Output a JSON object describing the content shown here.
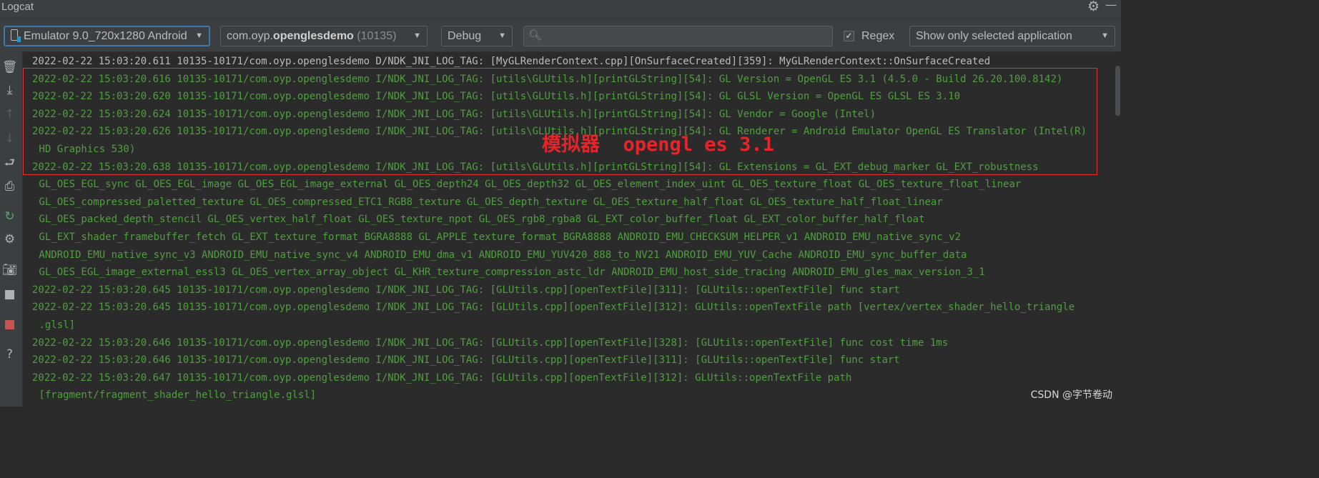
{
  "window": {
    "title": "Logcat"
  },
  "toolbar": {
    "device": "Emulator 9.0_720x1280 Android",
    "process_prefix": "com.oyp.",
    "process_bold": "openglesdemo",
    "process_pid": "(10135)",
    "log_level": "Debug",
    "search_value": "",
    "regex_checked": "✓",
    "regex_label": "Regex",
    "filter": "Show only selected application"
  },
  "sidebar_icons": [
    "trash-icon",
    "scroll-to-end-icon",
    "up-arrow-icon",
    "down-arrow-icon",
    "soft-wrap-icon",
    "print-icon",
    "restart-icon",
    "settings-icon",
    "screenshot-icon",
    "screen-record-icon",
    "stop-icon",
    "help-icon"
  ],
  "log_lines": [
    {
      "text": "2022-02-22 15:03:20.611 10135-10171/com.oyp.openglesdemo D/NDK_JNI_LOG_TAG: [MyGLRenderContext.cpp][OnSurfaceCreated][359]: MyGLRenderContext::OnSurfaceCreated",
      "level": "debug"
    },
    {
      "text": "2022-02-22 15:03:20.616 10135-10171/com.oyp.openglesdemo I/NDK_JNI_LOG_TAG: [utils\\GLUtils.h][printGLString][54]: GL Version = OpenGL ES 3.1 (4.5.0 - Build 26.20.100.8142)",
      "level": "info"
    },
    {
      "text": "2022-02-22 15:03:20.620 10135-10171/com.oyp.openglesdemo I/NDK_JNI_LOG_TAG: [utils\\GLUtils.h][printGLString][54]: GL GLSL Version = OpenGL ES GLSL ES 3.10",
      "level": "info"
    },
    {
      "text": "2022-02-22 15:03:20.624 10135-10171/com.oyp.openglesdemo I/NDK_JNI_LOG_TAG: [utils\\GLUtils.h][printGLString][54]: GL Vendor = Google (Intel)",
      "level": "info"
    },
    {
      "text": "2022-02-22 15:03:20.626 10135-10171/com.oyp.openglesdemo I/NDK_JNI_LOG_TAG: [utils\\GLUtils.h][printGLString][54]: GL Renderer = Android Emulator OpenGL ES Translator (Intel(R)",
      "level": "info"
    },
    {
      "text": " HD Graphics 530)",
      "level": "info"
    },
    {
      "text": "2022-02-22 15:03:20.638 10135-10171/com.oyp.openglesdemo I/NDK_JNI_LOG_TAG: [utils\\GLUtils.h][printGLString][54]: GL Extensions = GL_EXT_debug_marker GL_EXT_robustness",
      "level": "info"
    },
    {
      "text": " GL_OES_EGL_sync GL_OES_EGL_image GL_OES_EGL_image_external GL_OES_depth24 GL_OES_depth32 GL_OES_element_index_uint GL_OES_texture_float GL_OES_texture_float_linear",
      "level": "info"
    },
    {
      "text": " GL_OES_compressed_paletted_texture GL_OES_compressed_ETC1_RGB8_texture GL_OES_depth_texture GL_OES_texture_half_float GL_OES_texture_half_float_linear",
      "level": "info"
    },
    {
      "text": " GL_OES_packed_depth_stencil GL_OES_vertex_half_float GL_OES_texture_npot GL_OES_rgb8_rgba8 GL_EXT_color_buffer_float GL_EXT_color_buffer_half_float",
      "level": "info"
    },
    {
      "text": " GL_EXT_shader_framebuffer_fetch GL_EXT_texture_format_BGRA8888 GL_APPLE_texture_format_BGRA8888 ANDROID_EMU_CHECKSUM_HELPER_v1 ANDROID_EMU_native_sync_v2",
      "level": "info"
    },
    {
      "text": " ANDROID_EMU_native_sync_v3 ANDROID_EMU_native_sync_v4 ANDROID_EMU_dma_v1 ANDROID_EMU_YUV420_888_to_NV21 ANDROID_EMU_YUV_Cache ANDROID_EMU_sync_buffer_data",
      "level": "info"
    },
    {
      "text": " GL_OES_EGL_image_external_essl3 GL_OES_vertex_array_object GL_KHR_texture_compression_astc_ldr ANDROID_EMU_host_side_tracing ANDROID_EMU_gles_max_version_3_1",
      "level": "info"
    },
    {
      "text": "2022-02-22 15:03:20.645 10135-10171/com.oyp.openglesdemo I/NDK_JNI_LOG_TAG: [GLUtils.cpp][openTextFile][311]: [GLUtils::openTextFile] func start",
      "level": "info"
    },
    {
      "text": "2022-02-22 15:03:20.645 10135-10171/com.oyp.openglesdemo I/NDK_JNI_LOG_TAG: [GLUtils.cpp][openTextFile][312]: GLUtils::openTextFile path [vertex/vertex_shader_hello_triangle",
      "level": "info"
    },
    {
      "text": " .glsl]",
      "level": "info"
    },
    {
      "text": "2022-02-22 15:03:20.646 10135-10171/com.oyp.openglesdemo I/NDK_JNI_LOG_TAG: [GLUtils.cpp][openTextFile][328]: [GLUtils::openTextFile] func cost time 1ms",
      "level": "info"
    },
    {
      "text": "2022-02-22 15:03:20.646 10135-10171/com.oyp.openglesdemo I/NDK_JNI_LOG_TAG: [GLUtils.cpp][openTextFile][311]: [GLUtils::openTextFile] func start",
      "level": "info"
    },
    {
      "text": "2022-02-22 15:03:20.647 10135-10171/com.oyp.openglesdemo I/NDK_JNI_LOG_TAG: [GLUtils.cpp][openTextFile][312]: GLUtils::openTextFile path",
      "level": "info"
    },
    {
      "text": " [fragment/fragment_shader_hello_triangle.glsl]",
      "level": "info"
    }
  ],
  "annotation": {
    "text": "模拟器  opengl es 3.1",
    "color": "#e8232a"
  },
  "watermark": "CSDN @字节卷动",
  "colors": {
    "info": "#4f9f3f",
    "debug": "#bbbbbb",
    "highlight_border": "#e23434",
    "accent": "#3d77ab"
  }
}
